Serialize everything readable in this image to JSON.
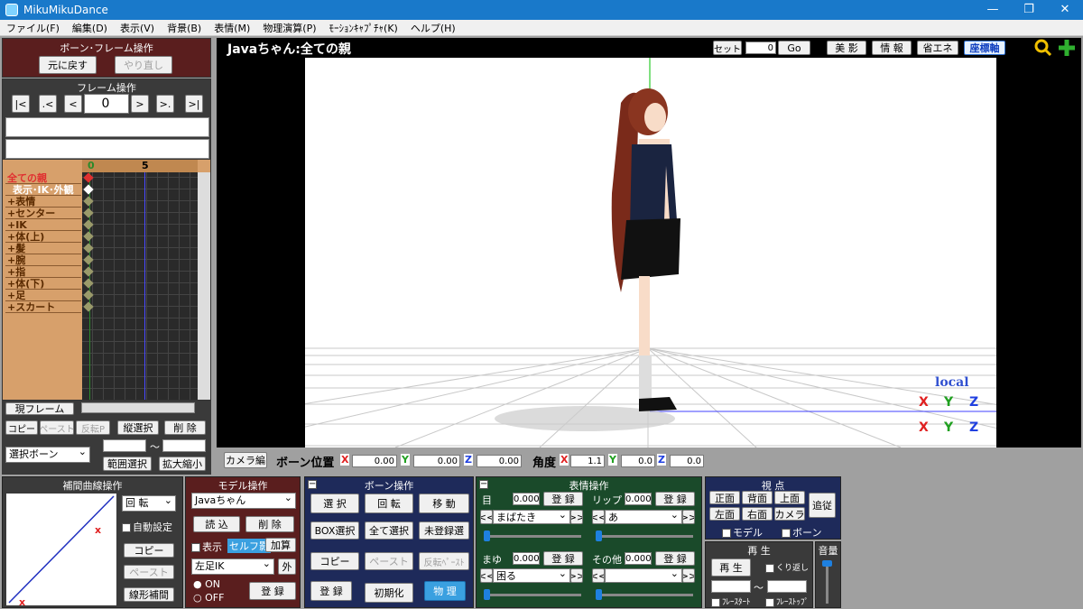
{
  "window": {
    "title": "MikuMikuDance"
  },
  "menu": [
    "ファイル(F)",
    "編集(D)",
    "表示(V)",
    "背景(B)",
    "表情(M)",
    "物理演算(P)",
    "ﾓｰｼｮﾝｷｬﾌﾟﾁｬ(K)",
    "ヘルプ(H)"
  ],
  "bone_frame": {
    "title": "ボーン･フレーム操作",
    "undo": "元に戻す",
    "redo": "やり直し"
  },
  "frame_ops": {
    "title": "フレーム操作",
    "frame_value": "0",
    "nav": [
      "|<",
      ".<",
      "<",
      ">",
      ">.",
      ">|"
    ]
  },
  "timeline": {
    "ticks": [
      "0",
      "5"
    ],
    "rows": [
      "全ての親",
      "表示･IK･外観",
      "+表情",
      "+センター",
      "+IK",
      "+体(上)",
      "+髪",
      "+腕",
      "+指",
      "+体(下)",
      "+足",
      "+スカート"
    ],
    "current_frame_btn": "現フレーム"
  },
  "frame_edit": {
    "copy": "コピー",
    "paste": "ペースト",
    "invert": "反転P",
    "v_select": "縦選択",
    "delete": "削 除",
    "select_bone": "選択ボーン",
    "tilde": "〜",
    "range_select": "範囲選択",
    "scale": "拡大縮小"
  },
  "viewport": {
    "title": "Javaちゃん:全ての親",
    "set_label": "セット",
    "set_value": "0",
    "go": "Go",
    "buttons": [
      "美 影",
      "情 報",
      "省エネ",
      "座標軸"
    ],
    "local_label": "local",
    "axes_labels": [
      "X",
      "Y",
      "Z"
    ]
  },
  "camera_bar": {
    "camera_btn": "カメラ編",
    "bone_pos": "ボーン位置",
    "pos": {
      "x": "0.00",
      "y": "0.00",
      "z": "0.00"
    },
    "angle": "角度",
    "rot": {
      "x": "1.1",
      "y": "0.0",
      "z": "0.0"
    }
  },
  "curve": {
    "title": "補間曲線操作",
    "rotate": "回 転",
    "auto": "自動設定",
    "copy": "コピー",
    "paste": "ペースト",
    "linear": "線形補間"
  },
  "model": {
    "title": "モデル操作",
    "model_name": "Javaちゃん",
    "load": "読 込",
    "delete": "削 除",
    "show": "表示",
    "self_shadow": "セルフ影",
    "add": "加算",
    "bone_name": "左足IK",
    "outer": "外",
    "on": "ON",
    "off": "OFF",
    "register": "登 録"
  },
  "bone_ops": {
    "title": "ボーン操作",
    "select": "選 択",
    "rotate": "回 転",
    "move": "移 動",
    "box_select": "BOX選択",
    "all_select": "全て選択",
    "unregistered": "未登録選",
    "copy": "コピー",
    "paste": "ペースト",
    "invert_paste": "反転ﾍﾟｰｽﾄ",
    "register": "登 録",
    "initialize": "初期化",
    "physics": "物 理"
  },
  "morph": {
    "title": "表情操作",
    "groups": [
      {
        "label": "目",
        "value": "0.000",
        "register": "登 録",
        "selected": "まばたき"
      },
      {
        "label": "リップ",
        "value": "0.000",
        "register": "登 録",
        "selected": "あ"
      },
      {
        "label": "まゆ",
        "value": "0.000",
        "register": "登 録",
        "selected": "困る"
      },
      {
        "label": "その他",
        "value": "0.000",
        "register": "登 録",
        "selected": ""
      }
    ]
  },
  "view": {
    "title": "視 点",
    "front": "正面",
    "back": "背面",
    "top": "上面",
    "follow": "追従",
    "left": "左面",
    "right": "右面",
    "camera": "カメラ",
    "model_chk": "モデル",
    "bone_chk": "ボーン"
  },
  "play": {
    "title": "再 生",
    "play_btn": "再 生",
    "repeat": "くり返し",
    "tilde": "〜",
    "frame_start": "ﾌﾚｰｽﾀｰﾄ",
    "frame_stop": "ﾌﾚｰｽﾄｯﾌﾟ"
  },
  "volume": {
    "title": "音量"
  }
}
